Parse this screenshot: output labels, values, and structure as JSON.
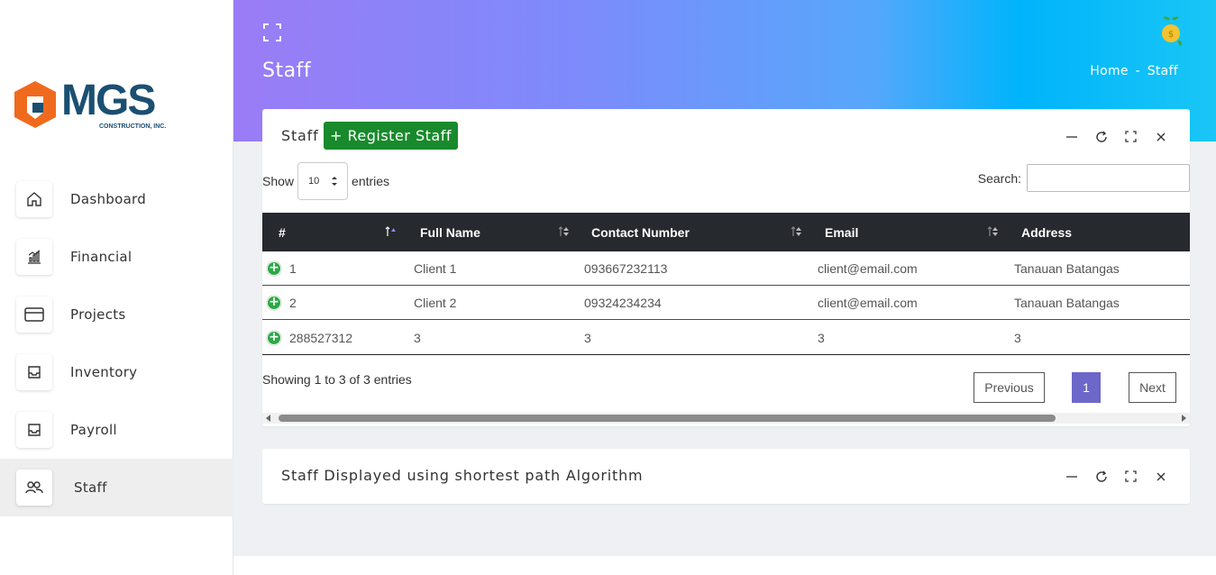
{
  "brand": {
    "name": "MGS",
    "tagline": "CONSTRUCTION, INC.",
    "primary_color": "#1b4f72",
    "accent_color": "#f06a1e"
  },
  "sidebar": {
    "items": [
      {
        "label": "Dashboard",
        "icon": "home-icon"
      },
      {
        "label": "Financial",
        "icon": "chart-icon"
      },
      {
        "label": "Projects",
        "icon": "credit-card-icon"
      },
      {
        "label": "Inventory",
        "icon": "inbox-icon"
      },
      {
        "label": "Payroll",
        "icon": "inbox-icon"
      },
      {
        "label": "Staff",
        "icon": "users-icon",
        "active": true
      }
    ]
  },
  "header": {
    "title": "Staff",
    "breadcrumb": {
      "home": "Home",
      "separator": "-",
      "current": "Staff"
    },
    "gradient": [
      "#9a7cf6",
      "#00b4fb"
    ]
  },
  "staff_card": {
    "title": "Staff",
    "register_button": "+ Register Staff",
    "register_color": "#198a2c",
    "length": {
      "prefix": "Show",
      "value": "10",
      "suffix": "entries"
    },
    "search_label": "Search:",
    "search_value": "",
    "columns": [
      "#",
      "Full Name",
      "Contact Number",
      "Email",
      "Address"
    ],
    "rows": [
      [
        "1",
        "Client 1",
        "093667232113",
        "client@email.com",
        "Tanauan Batangas"
      ],
      [
        "2",
        "Client 2",
        "09324234234",
        "client@email.com",
        "Tanauan Batangas"
      ],
      [
        "288527312",
        "3",
        "3",
        "3",
        "3"
      ]
    ],
    "info": "Showing 1 to 3 of 3 entries",
    "pagination": {
      "previous": "Previous",
      "current_page": "1",
      "next": "Next",
      "active_color": "#6c67c9"
    }
  },
  "path_card": {
    "title": "Staff Displayed using shortest path Algorithm"
  }
}
